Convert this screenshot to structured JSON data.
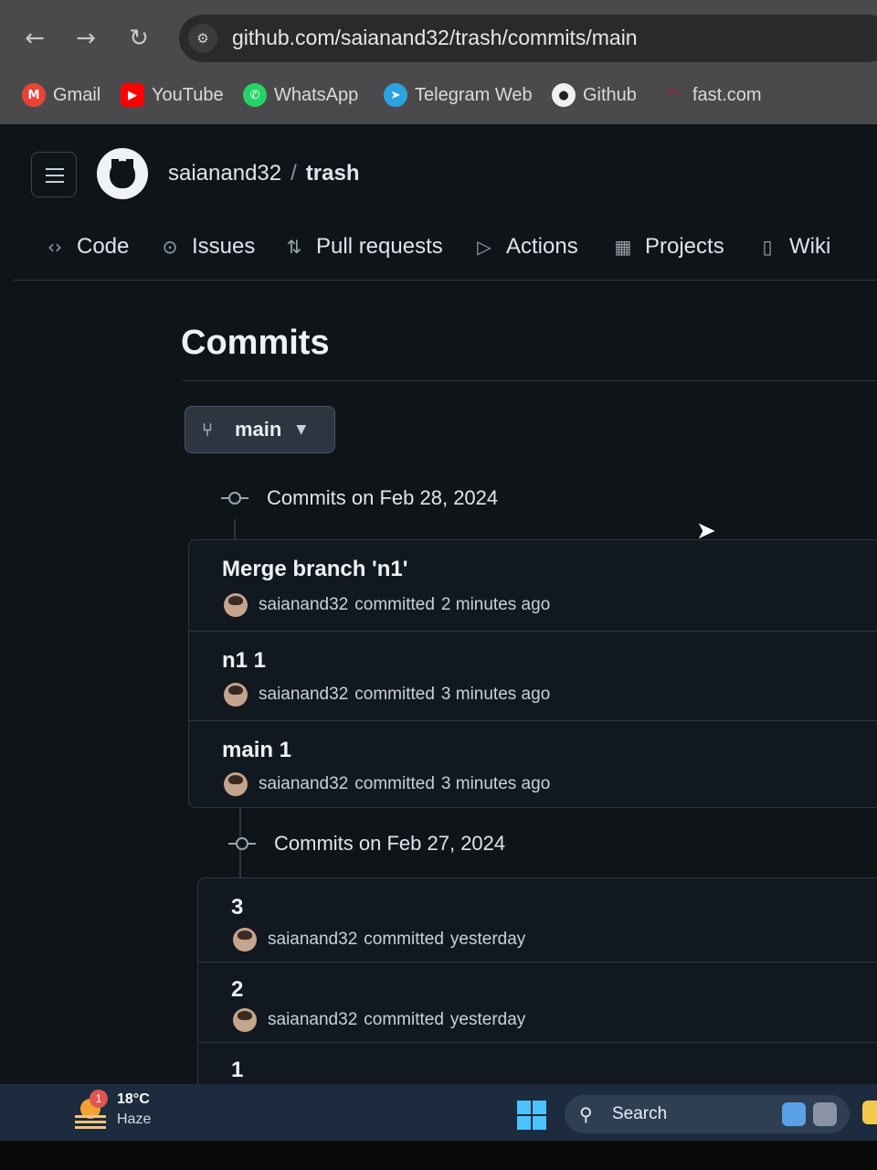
{
  "browser": {
    "url": "github.com/saianand32/trash/commits/main",
    "bookmarks": [
      {
        "label": "Gmail",
        "icon": "gmail-icon",
        "color": "#ea4335"
      },
      {
        "label": "YouTube",
        "icon": "youtube-icon",
        "color": "#ff0000"
      },
      {
        "label": "WhatsApp",
        "icon": "whatsapp-icon",
        "color": "#25d366"
      },
      {
        "label": "Telegram Web",
        "icon": "telegram-icon",
        "color": "#2aa3e0"
      },
      {
        "label": "Github",
        "icon": "github-icon",
        "color": "#f0f0f0"
      },
      {
        "label": "fast.com",
        "icon": "fast-icon",
        "color": "#e50914"
      }
    ]
  },
  "repo": {
    "owner": "saianand32",
    "separator": "/",
    "name": "trash"
  },
  "tabs": [
    {
      "label": "Code",
      "icon": "code-icon"
    },
    {
      "label": "Issues",
      "icon": "issues-icon"
    },
    {
      "label": "Pull requests",
      "icon": "pull-request-icon"
    },
    {
      "label": "Actions",
      "icon": "actions-icon"
    },
    {
      "label": "Projects",
      "icon": "projects-icon"
    },
    {
      "label": "Wiki",
      "icon": "wiki-icon"
    }
  ],
  "page": {
    "title": "Commits",
    "branch": "main"
  },
  "commit_groups": [
    {
      "heading": "Commits on Feb 28, 2024",
      "commits": [
        {
          "title": "Merge branch 'n1'",
          "author": "saianand32",
          "verb": "committed",
          "time": "2 minutes ago"
        },
        {
          "title": "n1 1",
          "author": "saianand32",
          "verb": "committed",
          "time": "3 minutes ago"
        },
        {
          "title": "main 1",
          "author": "saianand32",
          "verb": "committed",
          "time": "3 minutes ago"
        }
      ]
    },
    {
      "heading": "Commits on Feb 27, 2024",
      "commits": [
        {
          "title": "3",
          "author": "saianand32",
          "verb": "committed",
          "time": "yesterday"
        },
        {
          "title": "2",
          "author": "saianand32",
          "verb": "committed",
          "time": "yesterday"
        },
        {
          "title": "1"
        }
      ]
    }
  ],
  "taskbar": {
    "temperature": "18°C",
    "condition": "Haze",
    "notification_count": "1",
    "search_label": "Search"
  },
  "colors": {
    "accent": "#4cc2ff",
    "page_bg": "#0f1419",
    "border": "#30363d"
  }
}
